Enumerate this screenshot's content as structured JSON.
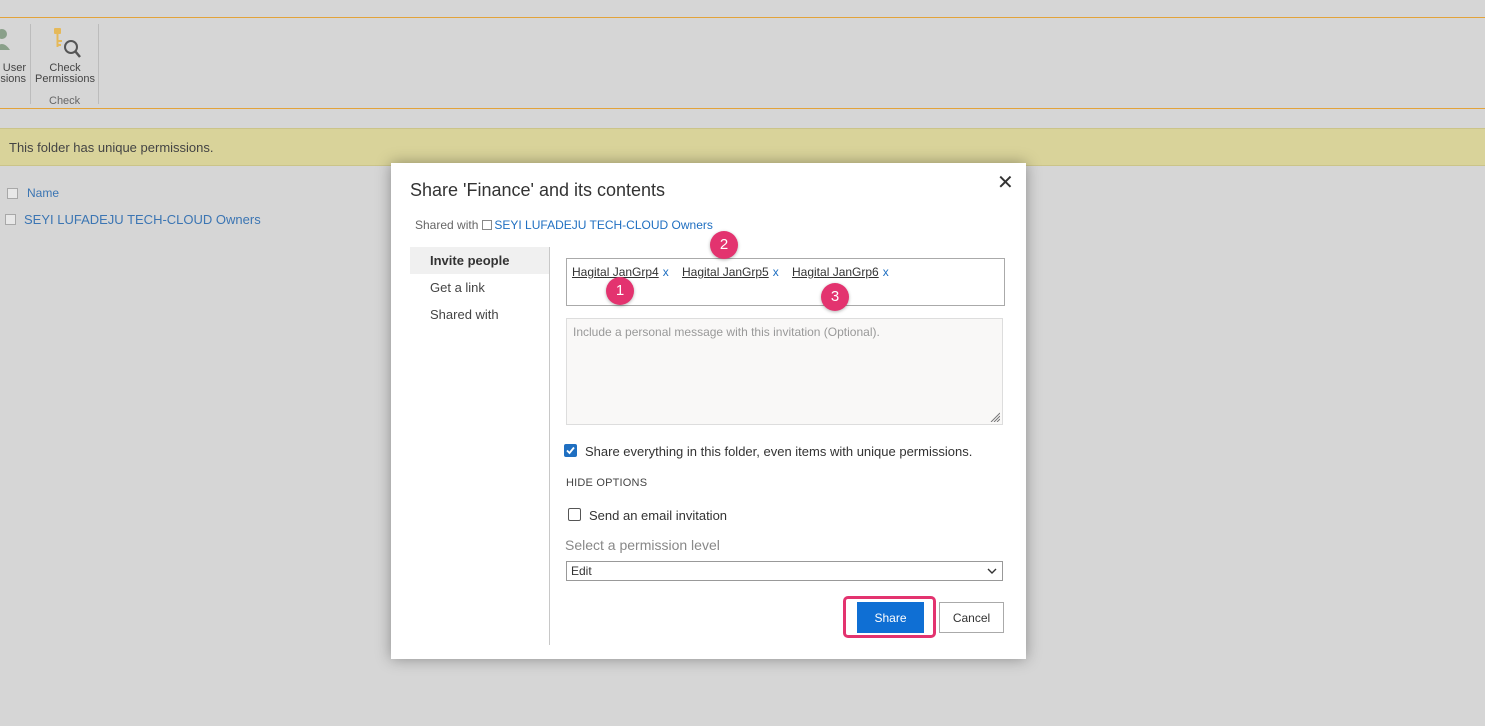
{
  "ribbon": {
    "user_perms_label_line1": "User",
    "user_perms_label_line2": "sions",
    "check_perms_line1": "Check",
    "check_perms_line2": "Permissions",
    "check_group_label": "Check"
  },
  "banner": {
    "text": "This folder has unique permissions."
  },
  "list": {
    "name_header": "Name",
    "rows": [
      {
        "name": "SEYI LUFADEJU TECH-CLOUD Owners"
      }
    ]
  },
  "dialog": {
    "title": "Share 'Finance' and its contents",
    "close_glyph": "✕",
    "shared_with_prefix": "Shared with",
    "shared_with_link": "SEYI LUFADEJU TECH-CLOUD Owners",
    "nav": [
      {
        "label": "Invite people",
        "active": true
      },
      {
        "label": "Get a link",
        "active": false
      },
      {
        "label": "Shared with",
        "active": false
      }
    ],
    "people": [
      {
        "name": "Hagital JanGrp4",
        "remove": "x"
      },
      {
        "name": "Hagital JanGrp5",
        "remove": "x"
      },
      {
        "name": "Hagital JanGrp6",
        "remove": "x"
      }
    ],
    "badges": [
      "1",
      "2",
      "3"
    ],
    "message_placeholder": "Include a personal message with this invitation (Optional).",
    "share_everything_label": "Share everything in this folder, even items with unique permissions.",
    "share_everything_checked": true,
    "hide_options": "HIDE OPTIONS",
    "send_email_label": "Send an email invitation",
    "send_email_checked": false,
    "permission_level_label": "Select a permission level",
    "permission_level_value": "Edit",
    "share_button": "Share",
    "cancel_button": "Cancel"
  },
  "colors": {
    "accent": "#0f6fd4",
    "highlight": "#e3336f",
    "banner": "#d9d39a"
  }
}
